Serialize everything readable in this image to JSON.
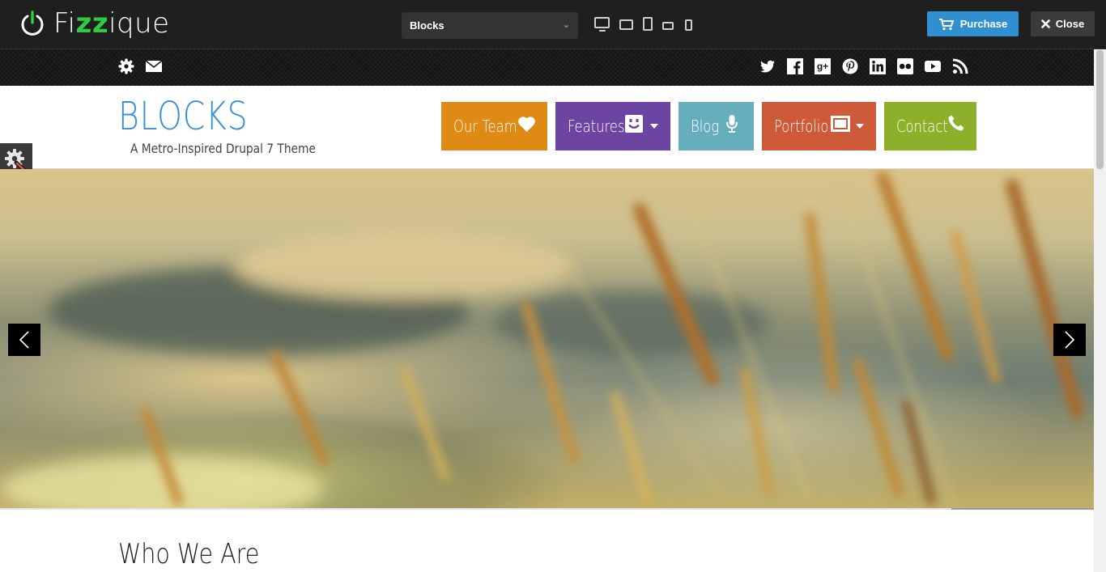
{
  "topbar": {
    "brand": {
      "prefix": "Fi",
      "highlight": "zz",
      "suffix": "ique"
    },
    "theme_select": {
      "value": "Blocks"
    },
    "devices": [
      "desktop-icon",
      "tablet-landscape-icon",
      "tablet-portrait-icon",
      "phone-landscape-icon",
      "phone-portrait-icon"
    ],
    "purchase_label": "Purchase",
    "close_label": "Close"
  },
  "strip": {
    "left_icons": [
      "gear-icon",
      "envelope-icon"
    ],
    "social_icons": [
      "twitter-icon",
      "facebook-icon",
      "google-plus-icon",
      "pinterest-icon",
      "linkedin-icon",
      "flickr-icon",
      "youtube-icon",
      "rss-icon"
    ]
  },
  "site": {
    "title": "BLOCKS",
    "tagline": "A Metro-Inspired Drupal 7 Theme"
  },
  "nav": [
    {
      "label": "Our Team",
      "color": "#df8a15",
      "icon": "heart-icon",
      "dropdown": false
    },
    {
      "label": "Features",
      "color": "#6c45a3",
      "icon": "smile-icon",
      "dropdown": true
    },
    {
      "label": "Blog",
      "color": "#66aebb",
      "icon": "microphone-icon",
      "dropdown": false
    },
    {
      "label": "Portfolio",
      "color": "#cf5a3a",
      "icon": "picture-icon",
      "dropdown": true
    },
    {
      "label": "Contact",
      "color": "#8db02b",
      "icon": "phone-icon",
      "dropdown": false
    }
  ],
  "slider": {
    "progress_fraction": 0.87
  },
  "content": {
    "heading": "Who We Are"
  },
  "colors": {
    "topbar_bg": "#1f1f1f",
    "brand_accent": "#2ecc40",
    "purchase_bg": "#2f8fd0",
    "title_blue": "#3a8fd8"
  }
}
